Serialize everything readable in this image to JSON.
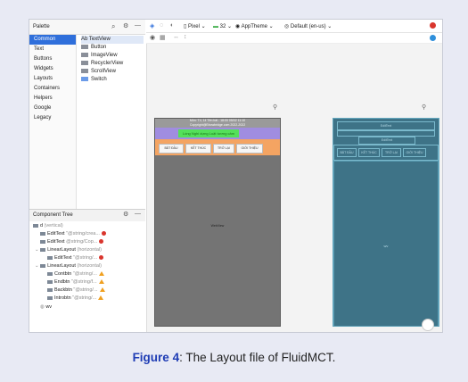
{
  "palette": {
    "title": "Palette",
    "categories": [
      "Common",
      "Text",
      "Buttons",
      "Widgets",
      "Layouts",
      "Containers",
      "Helpers",
      "Google",
      "Legacy"
    ],
    "selected_category": "Common",
    "widgets": [
      "Ab TextView",
      "Button",
      "ImageView",
      "RecyclerView",
      "ScrollView",
      "Switch"
    ]
  },
  "toolbar": {
    "device": "Pixel",
    "api": "32",
    "theme": "AppTheme",
    "locale": "Default (en-us)"
  },
  "component_tree": {
    "title": "Component Tree",
    "nodes": [
      {
        "name": "d",
        "detail": "(vertical)",
        "status": ""
      },
      {
        "name": "EditText",
        "detail": "\"@string/crea...",
        "status": "error"
      },
      {
        "name": "EditText",
        "detail": "@string/Cop...",
        "status": "error"
      },
      {
        "name": "LinearLayout",
        "detail": "(horizontal)",
        "status": ""
      },
      {
        "name": "EditText",
        "detail": "\"@string/...",
        "status": "error"
      },
      {
        "name": "LinearLayout",
        "detail": "(horizontal)",
        "status": ""
      },
      {
        "name": "Contbtn",
        "detail": "\"@string/...",
        "status": "warning"
      },
      {
        "name": "Endbtn",
        "detail": "\"@string/f...",
        "status": "warning"
      },
      {
        "name": "Backbtn",
        "detail": "\"@string/...",
        "status": "warning"
      },
      {
        "name": "Introbtn",
        "detail": "\"@string/...",
        "status": "warning"
      },
      {
        "name": "wv",
        "detail": "",
        "status": ""
      }
    ]
  },
  "phone": {
    "status_text_1": "Môn: T4, 14 Tên bài - 18:00 05/02 11:10",
    "status_text_2": "Copyright@Bhowbridge.com 2022-2022",
    "green_text": "Lòng Nghi dựng Luật tương cảm",
    "buttons": [
      "BẮT ĐẦU",
      "KẾT THÚC",
      "TRỞ LẠI",
      "GIỚI THIỆU"
    ],
    "webview_label": "WebView"
  },
  "blueprint": {
    "top_label": "EditText",
    "mid_label": "EditText",
    "buttons": [
      "BẮT ĐẦU",
      "KẾT THÚC",
      "TRỞ LẠI",
      "GIỚI THIỆU"
    ],
    "center_label": "wv"
  },
  "caption": {
    "figure": "Figure 4",
    "text": ": The Layout file of FluidMCT."
  },
  "colors": {
    "accent": "#2f6fdb",
    "phone_bg": "#747474",
    "purple_bar": "#a08de0",
    "green_box": "#54e05a",
    "orange_bar": "#f4a462",
    "blueprint_bg": "#3e7387",
    "error": "#d9352d",
    "warning": "#f0a020",
    "caption_blue": "#1e3cb4"
  }
}
